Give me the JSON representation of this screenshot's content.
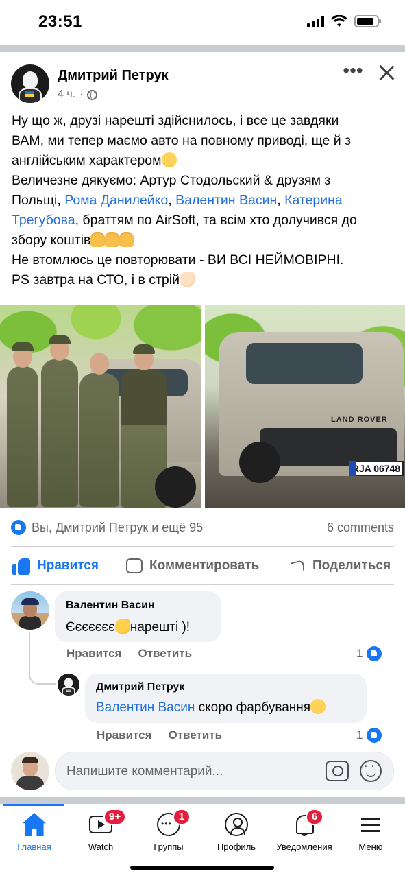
{
  "status_bar": {
    "time": "23:51"
  },
  "post": {
    "author": "Дмитрий Петрук",
    "time_ago": "4 ч.",
    "meta_separator": "·",
    "more_label": "•••",
    "text": {
      "l1": "Ну що ж, друзі нарешті здійснилось, і все це завдяки",
      "l2": "ВАМ, ми тепер маємо авто на повному приводі, ще й з",
      "l3": "англійським характером",
      "l4": "Величезне дякуємо: Артур Стодольский & друзям з",
      "l5_pre": "Польщі, ",
      "tag_roma": "Рома Данилейко",
      "comma1": ", ",
      "tag_valentin": "Валентин Васин",
      "comma2": ", ",
      "tag_kateryna_1": "Катерина",
      "tag_kateryna_2": "Трегубова",
      "l6_post": ", браттям по AirSoft, та всім хто долучився до",
      "l7": "збору коштів",
      "l8": "Не втомлюсь це повторювати - ВИ ВСІ НЕЙМОВІРНІ.",
      "l9": "PS завтра на СТО, і в стрій"
    },
    "photo_right": {
      "brand": "LAND ROVER",
      "plate": "RJA 06748"
    },
    "reactions": {
      "who": "Вы, Дмитрий Петрук и ещё 95",
      "comments": "6 comments"
    },
    "actions": {
      "like": "Нравится",
      "comment": "Комментировать",
      "share": "Поделиться"
    }
  },
  "comments": [
    {
      "author": "Валентин Васин",
      "text_pre": "Єєєєєєє",
      "text_post": "нарешті )!",
      "like_label": "Нравится",
      "reply_label": "Ответить",
      "likes": "1"
    },
    {
      "author": "Дмитрий Петрук",
      "mention": "Валентин Васин",
      "text": " скоро фарбування",
      "like_label": "Нравится",
      "reply_label": "Ответить",
      "likes": "1"
    }
  ],
  "composer": {
    "placeholder": "Напишите комментарий..."
  },
  "nav": [
    {
      "label": "Главная",
      "badge": ""
    },
    {
      "label": "Watch",
      "badge": "9+"
    },
    {
      "label": "Группы",
      "badge": "1"
    },
    {
      "label": "Профиль",
      "badge": ""
    },
    {
      "label": "Уведомления",
      "badge": "6"
    },
    {
      "label": "Меню",
      "badge": ""
    }
  ],
  "colors": {
    "accent": "#1877f2",
    "link": "#216fdb",
    "badge": "#e41e3f",
    "muted": "#65676b"
  }
}
